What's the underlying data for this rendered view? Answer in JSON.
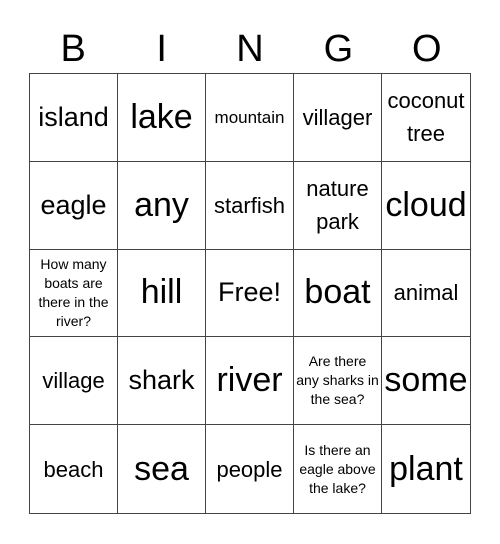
{
  "header": [
    "B",
    "I",
    "N",
    "G",
    "O"
  ],
  "cells": [
    {
      "text": "island",
      "size": "lg"
    },
    {
      "text": "lake",
      "size": "xl"
    },
    {
      "text": "mountain",
      "size": "sm"
    },
    {
      "text": "villager",
      "size": "md"
    },
    {
      "text": "coconut tree",
      "size": "md"
    },
    {
      "text": "eagle",
      "size": "lg"
    },
    {
      "text": "any",
      "size": "xl"
    },
    {
      "text": "starfish",
      "size": "md"
    },
    {
      "text": "nature park",
      "size": "md"
    },
    {
      "text": "cloud",
      "size": "xl"
    },
    {
      "text": "How many boats are there in the river?",
      "size": "xs"
    },
    {
      "text": "hill",
      "size": "xl"
    },
    {
      "text": "Free!",
      "size": "lg"
    },
    {
      "text": "boat",
      "size": "xl"
    },
    {
      "text": "animal",
      "size": "md"
    },
    {
      "text": "village",
      "size": "md"
    },
    {
      "text": "shark",
      "size": "lg"
    },
    {
      "text": "river",
      "size": "xl"
    },
    {
      "text": "Are there any sharks in the sea?",
      "size": "xs"
    },
    {
      "text": "some",
      "size": "xl"
    },
    {
      "text": "beach",
      "size": "md"
    },
    {
      "text": "sea",
      "size": "xl"
    },
    {
      "text": "people",
      "size": "md"
    },
    {
      "text": "Is there an eagle above the lake?",
      "size": "xs"
    },
    {
      "text": "plant",
      "size": "xl"
    }
  ]
}
